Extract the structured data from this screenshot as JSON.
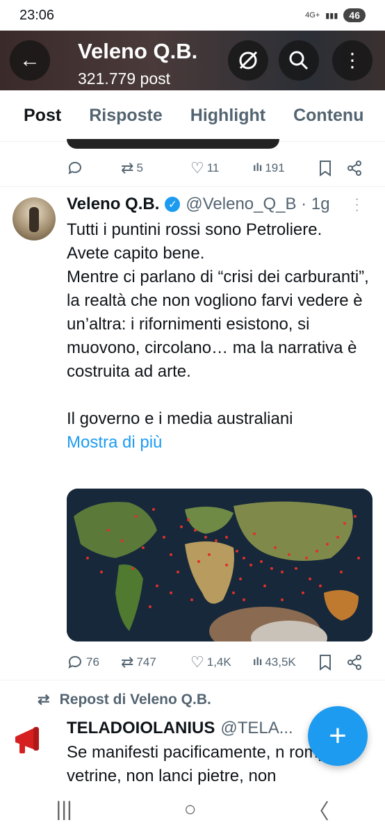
{
  "status": {
    "time": "23:06",
    "network": "4G+",
    "battery": "46"
  },
  "header": {
    "title": "Veleno Q.B.",
    "subtitle": "321.779 post"
  },
  "tabs": [
    "Post",
    "Risposte",
    "Highlight",
    "Contenu"
  ],
  "prev_post": {
    "replies": "",
    "reposts": "5",
    "likes": "11",
    "views": "191"
  },
  "post": {
    "name": "Veleno Q.B.",
    "handle": "@Veleno_Q_B · 1g",
    "lines": [
      "Tutti i puntini rossi sono Petroliere.",
      "Avete capito bene.",
      "Mentre ci parlano di “crisi dei carburanti”, la realtà che non vogliono farvi vedere è un’altra: i rifornimenti esistono, si muovono, circolano… ma la narrativa è costruita ad arte.",
      "",
      "Il governo e i media australiani"
    ],
    "show_more": "Mostra di più",
    "replies": "76",
    "reposts": "747",
    "likes": "1,4K",
    "views": "43,5K"
  },
  "repost_label": "Repost di Veleno Q.B.",
  "post2": {
    "name": "TELADOIOLANIUS",
    "handle": "@TELA...",
    "text": "Se manifesti pacificamente, n rompi vetrine, non lanci pietre, non"
  },
  "colors": {
    "accent": "#1d9bf0",
    "text": "#0f1419",
    "secondary": "#536471"
  }
}
